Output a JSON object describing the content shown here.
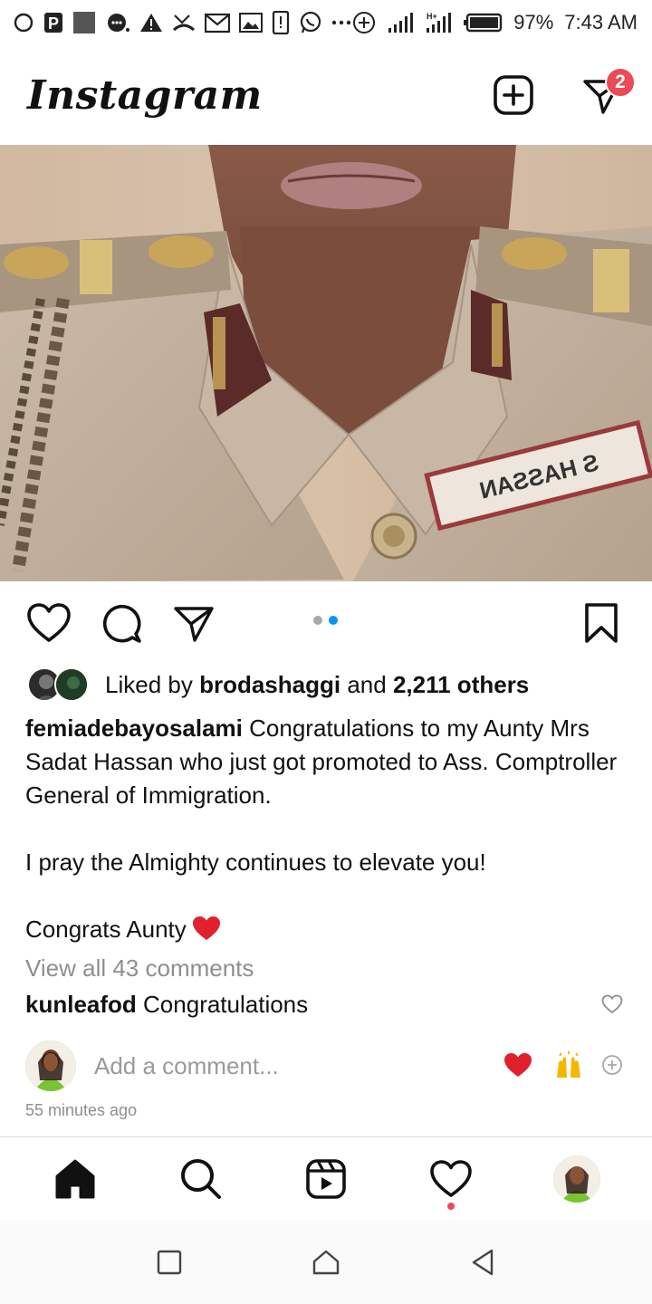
{
  "status_bar": {
    "battery": "97%",
    "time": "7:43 AM",
    "network": "H+"
  },
  "header": {
    "logo": "Instagram",
    "messages_badge": "2"
  },
  "post": {
    "photo_alt": "",
    "name_tag": "S HASSAN",
    "carousel": {
      "current": 2,
      "total": 2
    },
    "likes": {
      "prefix": "Liked by",
      "user": "brodashaggi",
      "joiner": "and",
      "others": "2,211 others"
    },
    "caption": {
      "username": "femiadebayosalami",
      "line1": "Congratulations to my Aunty Mrs Sadat Hassan who just got promoted to Ass. Comptroller General of Immigration.",
      "line2": "I pray the Almighty continues to elevate you!",
      "line3": "Congrats Aunty"
    },
    "view_all_comments": "View all 43 comments",
    "top_comment": {
      "username": "kunleafod",
      "text": "Congratulations"
    },
    "add_comment_placeholder": "Add a comment...",
    "timestamp": "55 minutes ago"
  },
  "icons": {
    "like": "heart-icon",
    "comment": "comment-icon",
    "share": "send-icon",
    "save": "bookmark-icon",
    "new_post": "plus-square-icon",
    "messages": "direct-icon",
    "home": "home-icon",
    "search": "search-icon",
    "reels": "reels-icon",
    "activity": "heart-icon"
  },
  "colors": {
    "accent_blue": "#0095f6",
    "badge_red": "#ed4956",
    "heart_red": "#e0202c",
    "muted_text": "#8e8e8e"
  }
}
